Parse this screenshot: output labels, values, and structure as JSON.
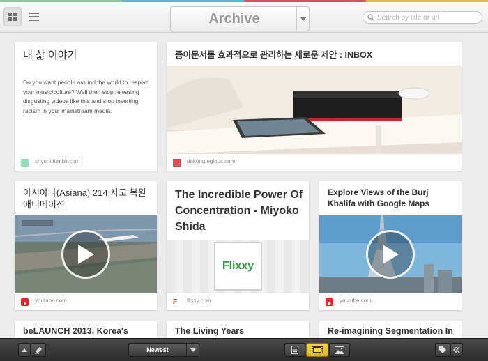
{
  "header": {
    "title": "Archive",
    "search_placeholder": "Search by title or url"
  },
  "colors": {
    "strip": [
      "#7dcf9f",
      "#5bb5c9",
      "#d9536a",
      "#f2b84b"
    ],
    "accent_active": "#e8c42e"
  },
  "cards": [
    {
      "title": "내 삶 이야기",
      "excerpt": "Do you want people around the world to respect your music/culture? Well then stop releasing disgusting videos like this and stop inserting racism in your mainstream media.",
      "source": "shyuni.tumblr.com",
      "favicon_color": "#8fe0b4"
    },
    {
      "title": "종이문서를 효과적으로 관리하는 새로운 제안 : INBOX",
      "source": "dekong.egloos.com",
      "favicon_color": "#e24b52"
    },
    {
      "title": "아시아나(Asiana) 214 사고 복원 애니메이션",
      "source": "youtube.com",
      "favicon_color": "#d92a23",
      "video": true
    },
    {
      "title": "The Incredible Power Of Concentration - Miyoko Shida",
      "source": "flixxy.com",
      "favicon_color": "#d92a23",
      "logo_text": "Flixxy"
    },
    {
      "title": "Explore Views of the Burj Khalifa with Google Maps",
      "source": "youtube.com",
      "favicon_color": "#d92a23",
      "video": true
    },
    {
      "title": "beLAUNCH 2013, Korea's"
    },
    {
      "title": "The Living Years"
    },
    {
      "title": "Re-imagining Segmentation In"
    }
  ],
  "toolbar": {
    "sort_label": "Newest"
  }
}
